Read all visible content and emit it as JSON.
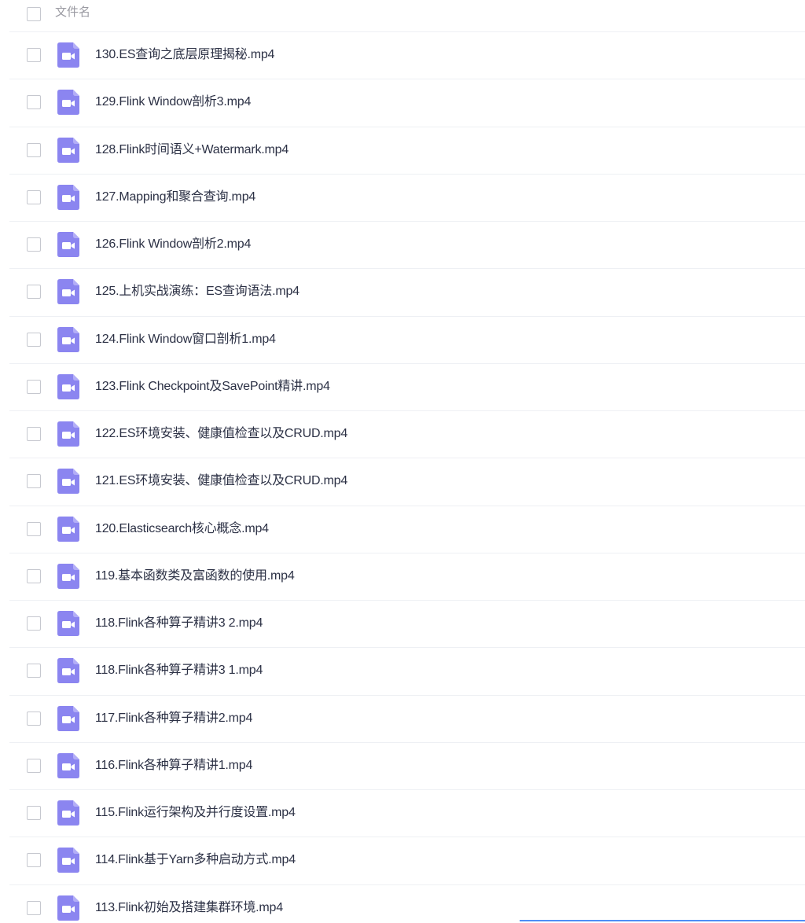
{
  "header": {
    "column_label": "文件名"
  },
  "files": [
    {
      "name": "130.ES查询之底层原理揭秘.mp4",
      "icon": "video-file-icon"
    },
    {
      "name": "129.Flink Window剖析3.mp4",
      "icon": "video-file-icon"
    },
    {
      "name": "128.Flink时间语义+Watermark.mp4",
      "icon": "video-file-icon"
    },
    {
      "name": "127.Mapping和聚合查询.mp4",
      "icon": "video-file-icon"
    },
    {
      "name": "126.Flink Window剖析2.mp4",
      "icon": "video-file-icon"
    },
    {
      "name": "125.上机实战演练：ES查询语法.mp4",
      "icon": "video-file-icon"
    },
    {
      "name": "124.Flink Window窗口剖析1.mp4",
      "icon": "video-file-icon"
    },
    {
      "name": "123.Flink Checkpoint及SavePoint精讲.mp4",
      "icon": "video-file-icon"
    },
    {
      "name": "122.ES环境安装、健康值检查以及CRUD.mp4",
      "icon": "video-file-icon"
    },
    {
      "name": "121.ES环境安装、健康值检查以及CRUD.mp4",
      "icon": "video-file-icon"
    },
    {
      "name": "120.Elasticsearch核心概念.mp4",
      "icon": "video-file-icon"
    },
    {
      "name": "119.基本函数类及富函数的使用.mp4",
      "icon": "video-file-icon"
    },
    {
      "name": "118.Flink各种算子精讲3 2.mp4",
      "icon": "video-file-icon"
    },
    {
      "name": "118.Flink各种算子精讲3 1.mp4",
      "icon": "video-file-icon"
    },
    {
      "name": "117.Flink各种算子精讲2.mp4",
      "icon": "video-file-icon"
    },
    {
      "name": "116.Flink各种算子精讲1.mp4",
      "icon": "video-file-icon"
    },
    {
      "name": "115.Flink运行架构及并行度设置.mp4",
      "icon": "video-file-icon"
    },
    {
      "name": "114.Flink基于Yarn多种启动方式.mp4",
      "icon": "video-file-icon"
    },
    {
      "name": "113.Flink初始及搭建集群环境.mp4",
      "icon": "video-file-icon"
    }
  ],
  "colors": {
    "icon_purple": "#8b85f0",
    "text": "#2c3145",
    "header_text": "#9a9aa2",
    "divider": "#eef0f4",
    "accent_bar": "#4d8ef6"
  }
}
